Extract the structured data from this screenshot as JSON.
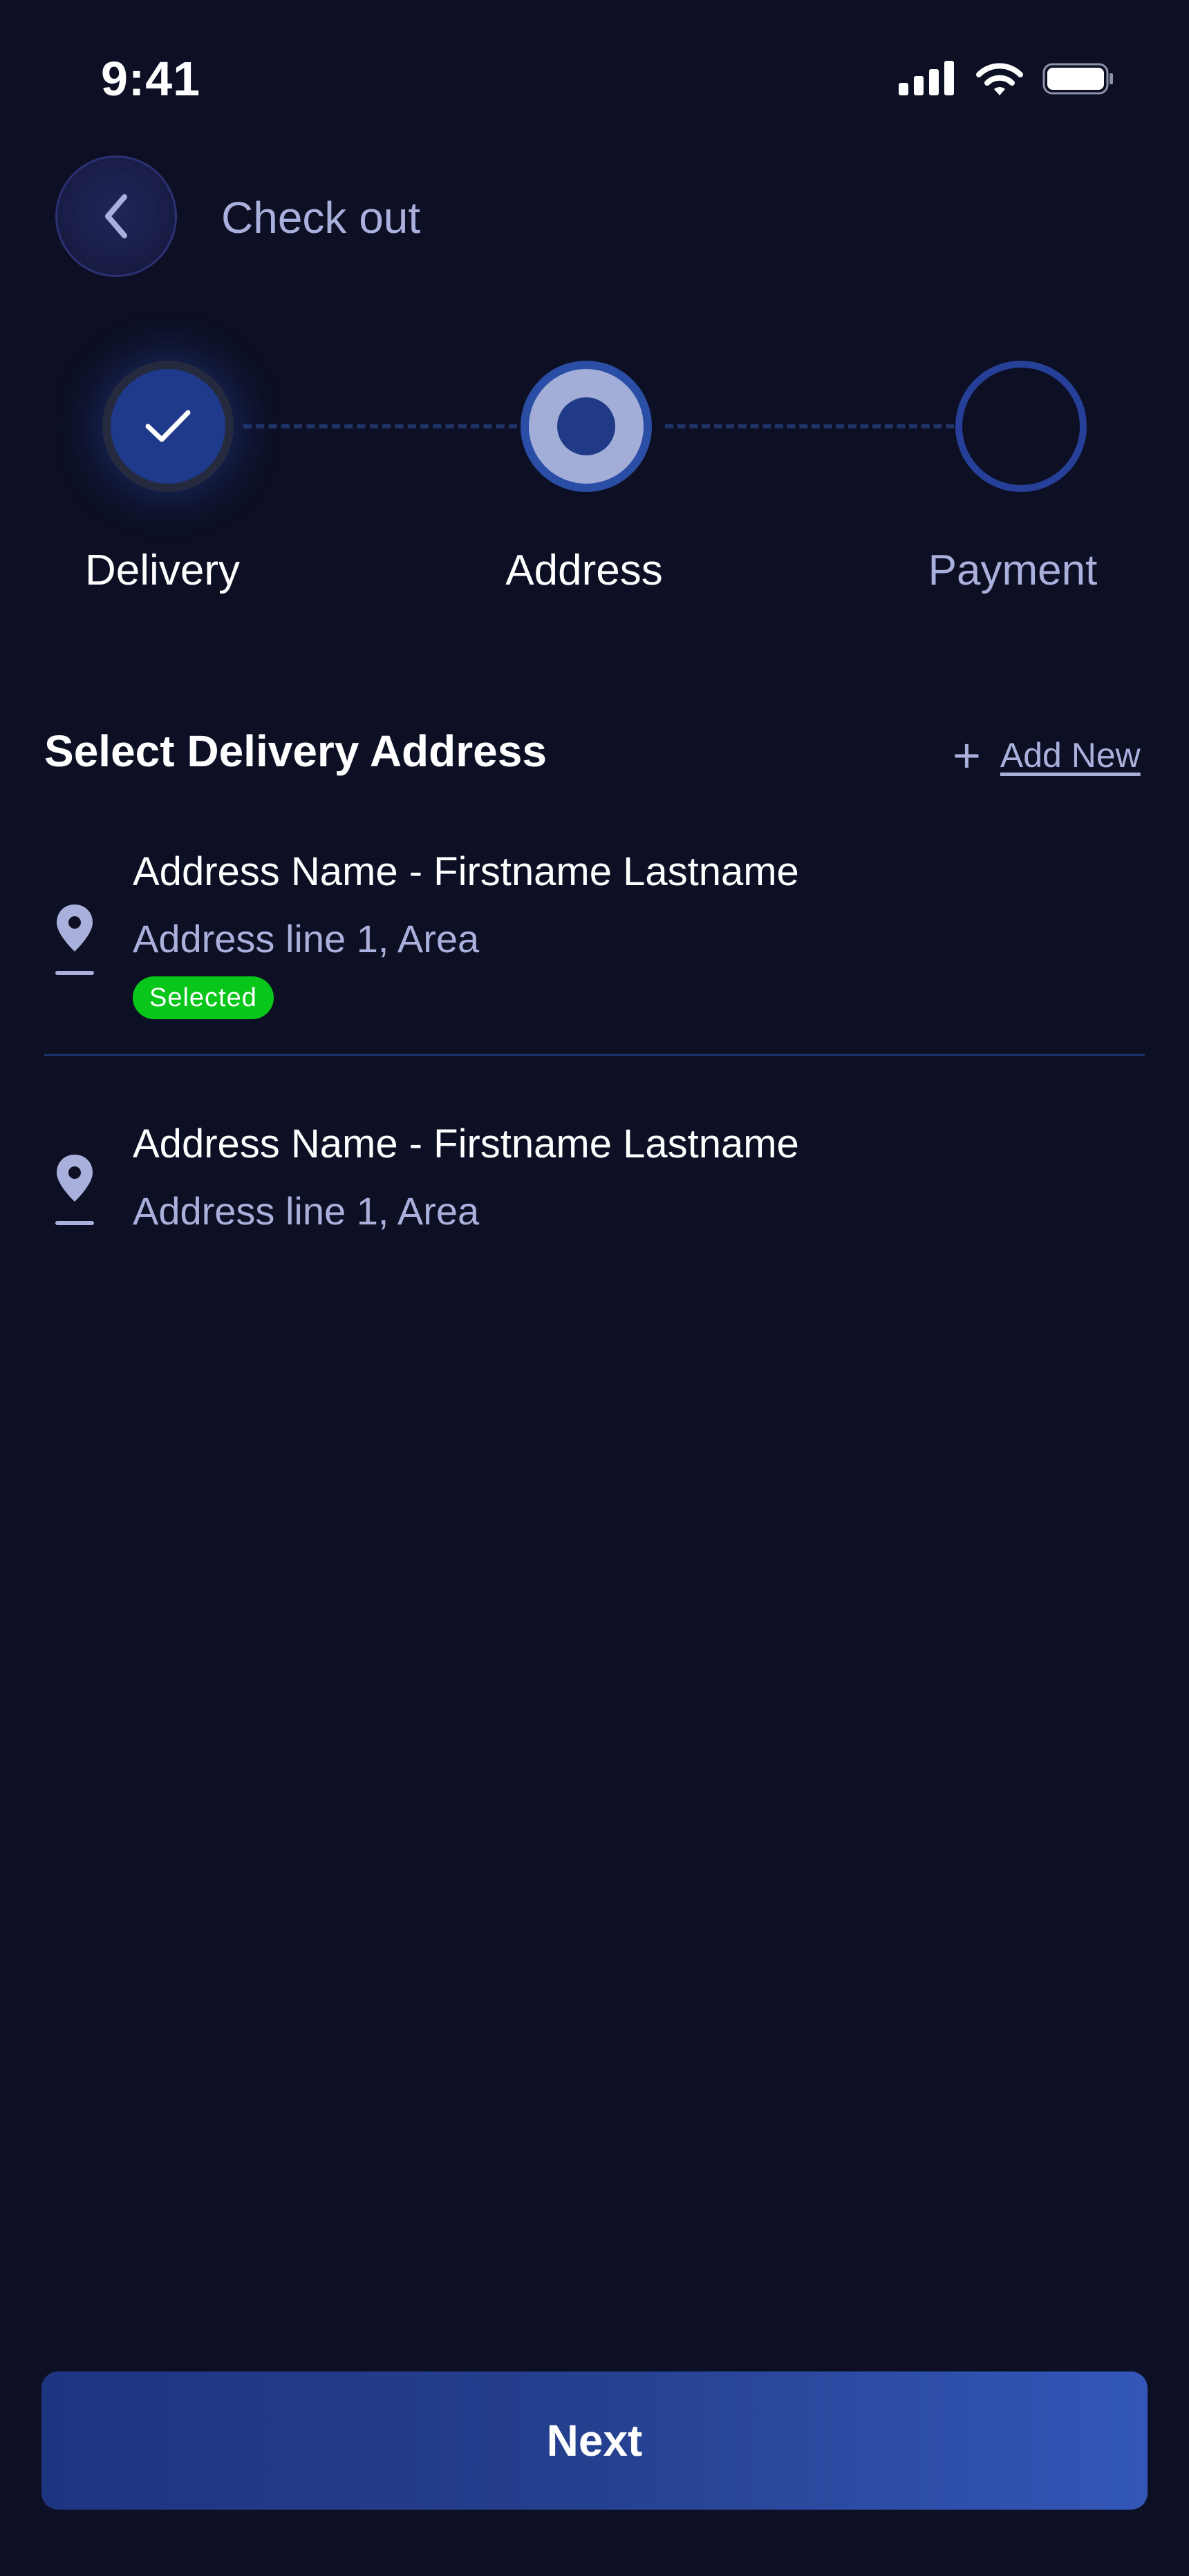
{
  "status_bar": {
    "time": "9:41",
    "icons": [
      "signal-icon",
      "wifi-icon",
      "battery-icon"
    ]
  },
  "header": {
    "title": "Check out",
    "back_icon": "chevron-left-icon"
  },
  "stepper": {
    "steps": [
      {
        "label": "Delivery",
        "state": "completed"
      },
      {
        "label": "Address",
        "state": "current"
      },
      {
        "label": "Payment",
        "state": "upcoming"
      }
    ]
  },
  "section": {
    "title": "Select Delivery Address",
    "add_new_label": "Add New",
    "add_icon": "plus-icon"
  },
  "addresses": [
    {
      "name": "Address Name - Firstname Lastname",
      "line": "Address line 1, Area",
      "badge": "Selected",
      "icon": "location-pin-icon"
    },
    {
      "name": "Address Name - Firstname Lastname",
      "line": "Address line 1, Area",
      "icon": "location-pin-icon"
    }
  ],
  "footer": {
    "next_label": "Next"
  },
  "colors": {
    "background": "#0d1024",
    "accent": "#1f3a8a",
    "muted_text": "#a9b0dc",
    "selected_badge": "#08c61a"
  }
}
